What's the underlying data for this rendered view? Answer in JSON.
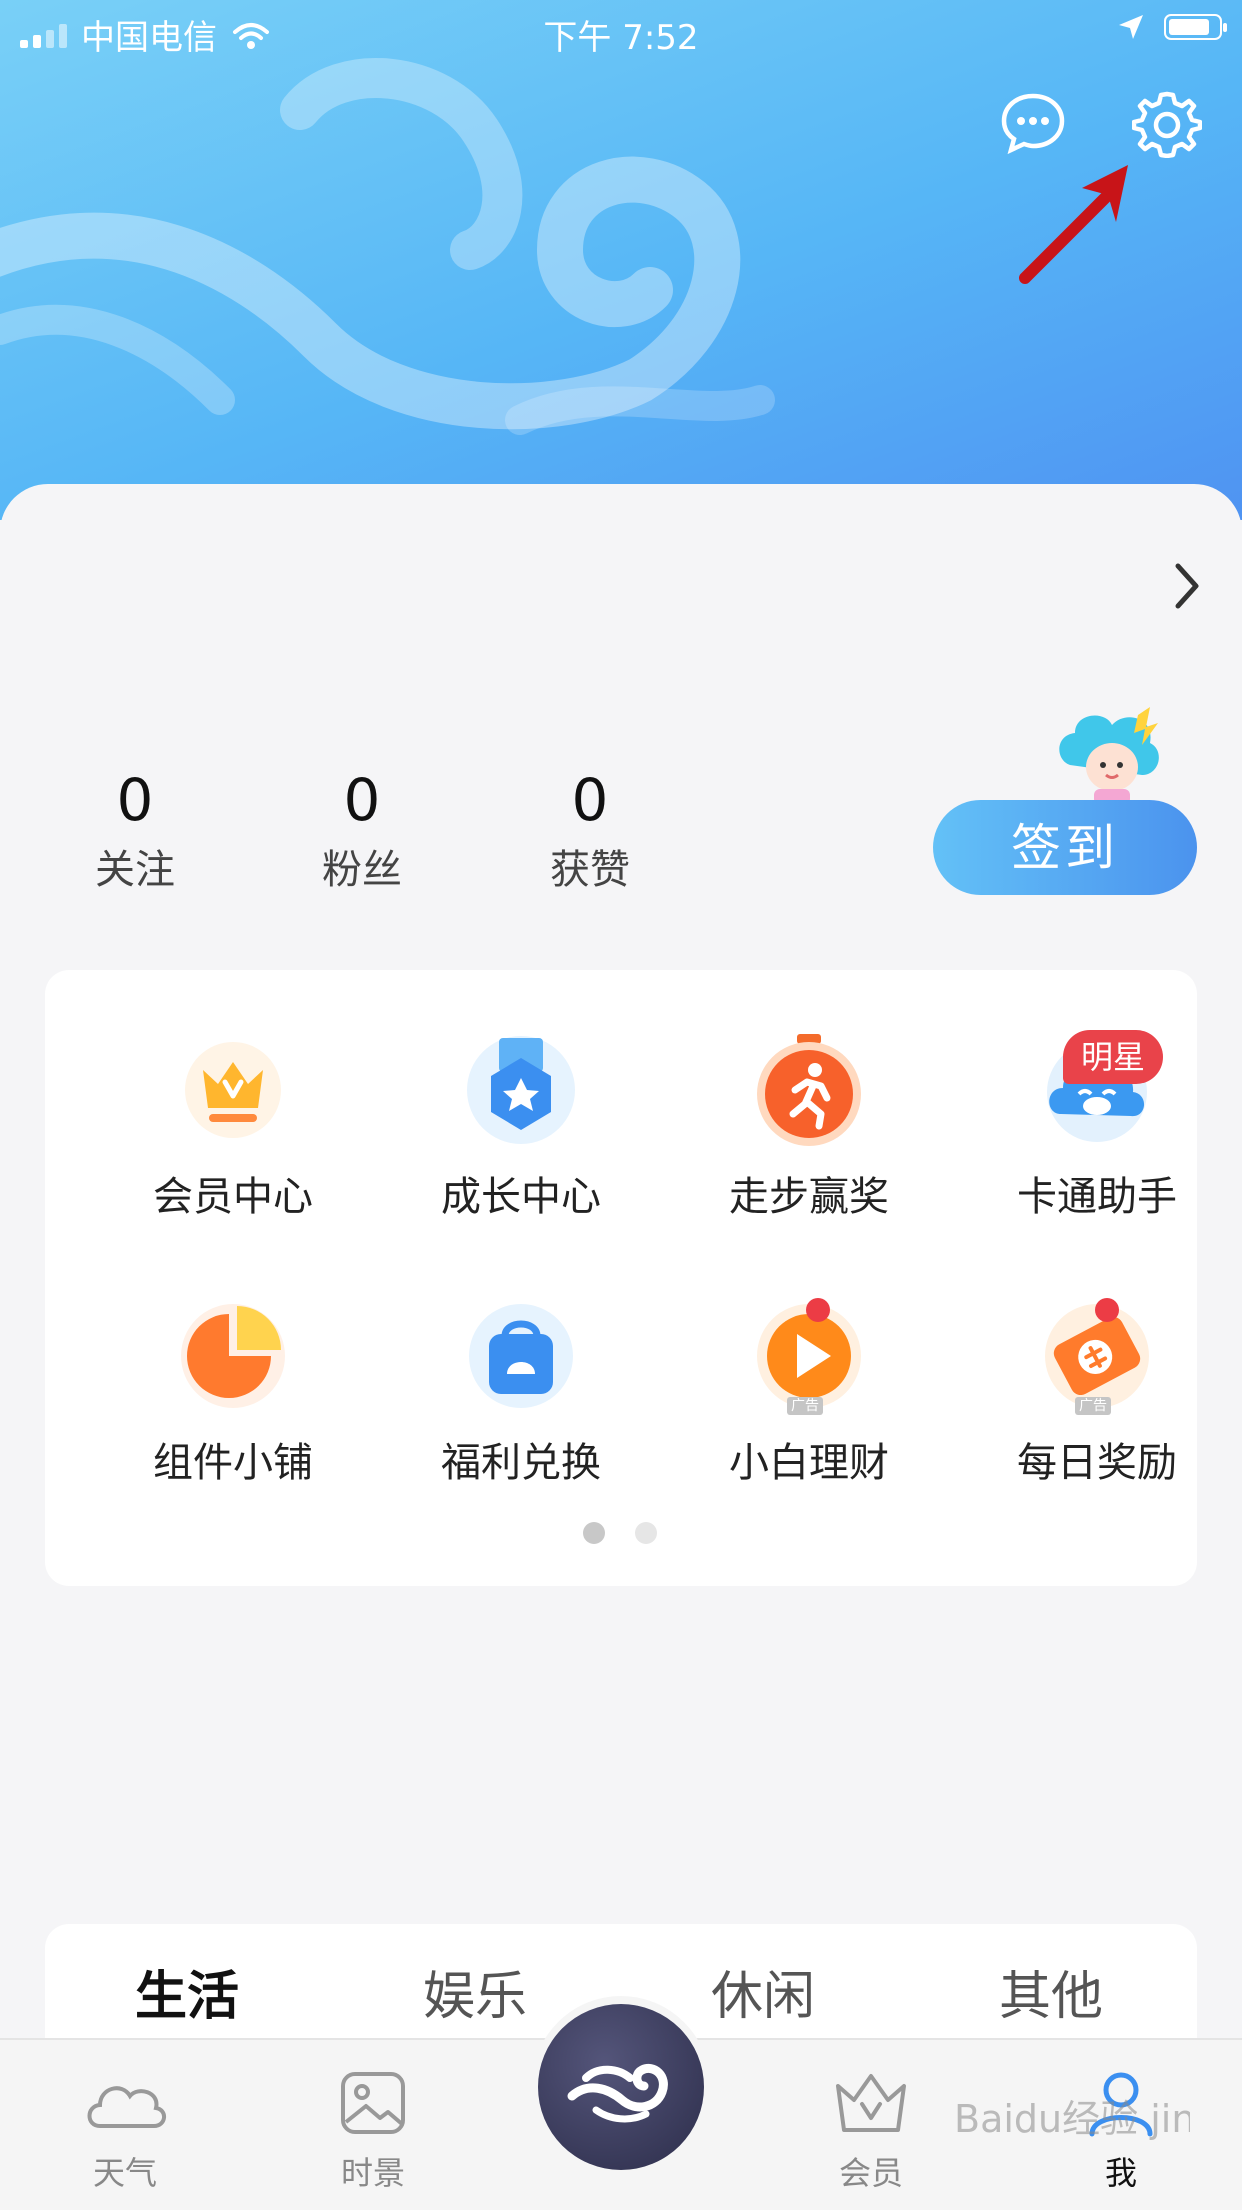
{
  "status_bar": {
    "carrier": "中国电信",
    "time": "下午 7:52"
  },
  "header": {
    "message_icon": "chat-bubble-icon",
    "settings_icon": "gear-icon"
  },
  "stats": [
    {
      "value": "0",
      "label": "关注"
    },
    {
      "value": "0",
      "label": "粉丝"
    },
    {
      "value": "0",
      "label": "获赞"
    }
  ],
  "signin_label": "签到",
  "grid": {
    "items": [
      {
        "label": "会员中心",
        "icon": "crown-icon"
      },
      {
        "label": "成长中心",
        "icon": "medal-icon"
      },
      {
        "label": "走步赢奖",
        "icon": "running-icon"
      },
      {
        "label": "卡通助手",
        "icon": "cartoon-cloud-icon"
      },
      {
        "label": "组件小铺",
        "icon": "pie-chart-icon"
      },
      {
        "label": "福利兑换",
        "icon": "shopping-bag-icon"
      },
      {
        "label": "小白理财",
        "icon": "play-icon"
      },
      {
        "label": "每日奖励",
        "icon": "ticket-icon"
      }
    ],
    "badge_star": "明星",
    "ad_tag": "广告",
    "page_indicator": {
      "pages": 2,
      "current": 1
    }
  },
  "tabs": [
    "生活",
    "娱乐",
    "休闲",
    "其他"
  ],
  "bottom_nav": [
    {
      "label": "天气",
      "icon": "cloud-icon"
    },
    {
      "label": "时景",
      "icon": "image-icon"
    },
    {
      "label": "会员",
      "icon": "crown-outline-icon"
    },
    {
      "label": "我",
      "icon": "person-icon"
    }
  ],
  "watermark": "Baidu经验 jingyan.baidu.com",
  "colors": {
    "header_gradient_start": "#79d0f7",
    "header_gradient_end": "#4f93f2",
    "signin_start": "#63c1f7",
    "signin_end": "#4b93ee",
    "badge_red": "#e9434a",
    "arrow_red": "#c81418"
  }
}
